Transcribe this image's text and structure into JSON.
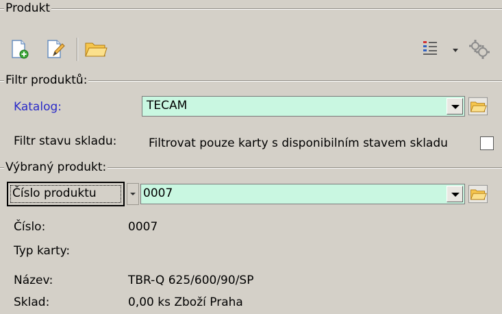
{
  "product_group": {
    "title": "Produkt"
  },
  "toolbar": {
    "new_icon": "new-document-icon",
    "edit_icon": "edit-document-icon",
    "open_icon": "folder-icon",
    "sort_icon": "sort-icon",
    "settings_icon": "gear-icon"
  },
  "filter_group": {
    "title": "Filtr produktů:",
    "catalog_label": "Katalog:",
    "catalog_value": "TECAM",
    "stock_filter_label": "Filtr stavu skladu:",
    "stock_filter_checkbox_label": "Filtrovat pouze karty s disponibilním stavem skladu",
    "stock_filter_checked": false
  },
  "selected_group": {
    "title": "Výbraný produkt:",
    "lookup_button_label": "Číslo produktu",
    "lookup_value": "0007",
    "fields": [
      {
        "label": "Číslo:",
        "value": "0007"
      },
      {
        "label": "Typ karty:",
        "value": ""
      },
      {
        "label": "Název:",
        "value": "TBR-Q 625/600/90/SP"
      },
      {
        "label": "Sklad:",
        "value": "0,00 ks Zboží Praha"
      }
    ]
  },
  "colors": {
    "field_bg": "#c9f7e1",
    "panel_bg": "#d4d0c8",
    "label_blue": "#2a2ac8"
  }
}
